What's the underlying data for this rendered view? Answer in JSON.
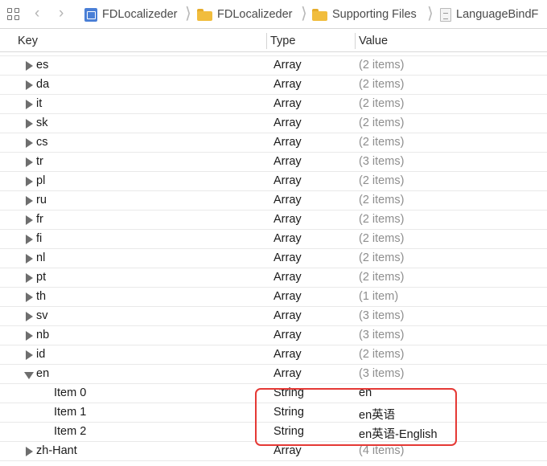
{
  "breadcrumb": {
    "items": [
      {
        "label": "FDLocalizeder",
        "icon": "project-icon"
      },
      {
        "label": "FDLocalizeder",
        "icon": "folder-icon"
      },
      {
        "label": "Supporting Files",
        "icon": "folder-icon"
      },
      {
        "label": "LanguageBindF",
        "icon": "plist-file-icon"
      }
    ]
  },
  "columns": {
    "key": "Key",
    "type": "Type",
    "value": "Value"
  },
  "rows": [
    {
      "key": "es",
      "type": "Array",
      "value": "(2 items)"
    },
    {
      "key": "da",
      "type": "Array",
      "value": "(2 items)"
    },
    {
      "key": "it",
      "type": "Array",
      "value": "(2 items)"
    },
    {
      "key": "sk",
      "type": "Array",
      "value": "(2 items)"
    },
    {
      "key": "cs",
      "type": "Array",
      "value": "(2 items)"
    },
    {
      "key": "tr",
      "type": "Array",
      "value": "(3 items)"
    },
    {
      "key": "pl",
      "type": "Array",
      "value": "(2 items)"
    },
    {
      "key": "ru",
      "type": "Array",
      "value": "(2 items)"
    },
    {
      "key": "fr",
      "type": "Array",
      "value": "(2 items)"
    },
    {
      "key": "fi",
      "type": "Array",
      "value": "(2 items)"
    },
    {
      "key": "nl",
      "type": "Array",
      "value": "(2 items)"
    },
    {
      "key": "pt",
      "type": "Array",
      "value": "(2 items)"
    },
    {
      "key": "th",
      "type": "Array",
      "value": "(1 item)"
    },
    {
      "key": "sv",
      "type": "Array",
      "value": "(3 items)"
    },
    {
      "key": "nb",
      "type": "Array",
      "value": "(3 items)"
    },
    {
      "key": "id",
      "type": "Array",
      "value": "(2 items)"
    },
    {
      "key": "en",
      "type": "Array",
      "value": "(3 items)"
    },
    {
      "key": "Item 0",
      "type": "String",
      "value": "en"
    },
    {
      "key": "Item 1",
      "type": "String",
      "value": "en英语"
    },
    {
      "key": "Item 2",
      "type": "String",
      "value": "en英语-English"
    },
    {
      "key": "zh-Hant",
      "type": "Array",
      "value": "(4 items)"
    }
  ],
  "colors": {
    "highlight": "#e53935",
    "folder": "#f1bd3d",
    "project": "#4a7fd6"
  }
}
